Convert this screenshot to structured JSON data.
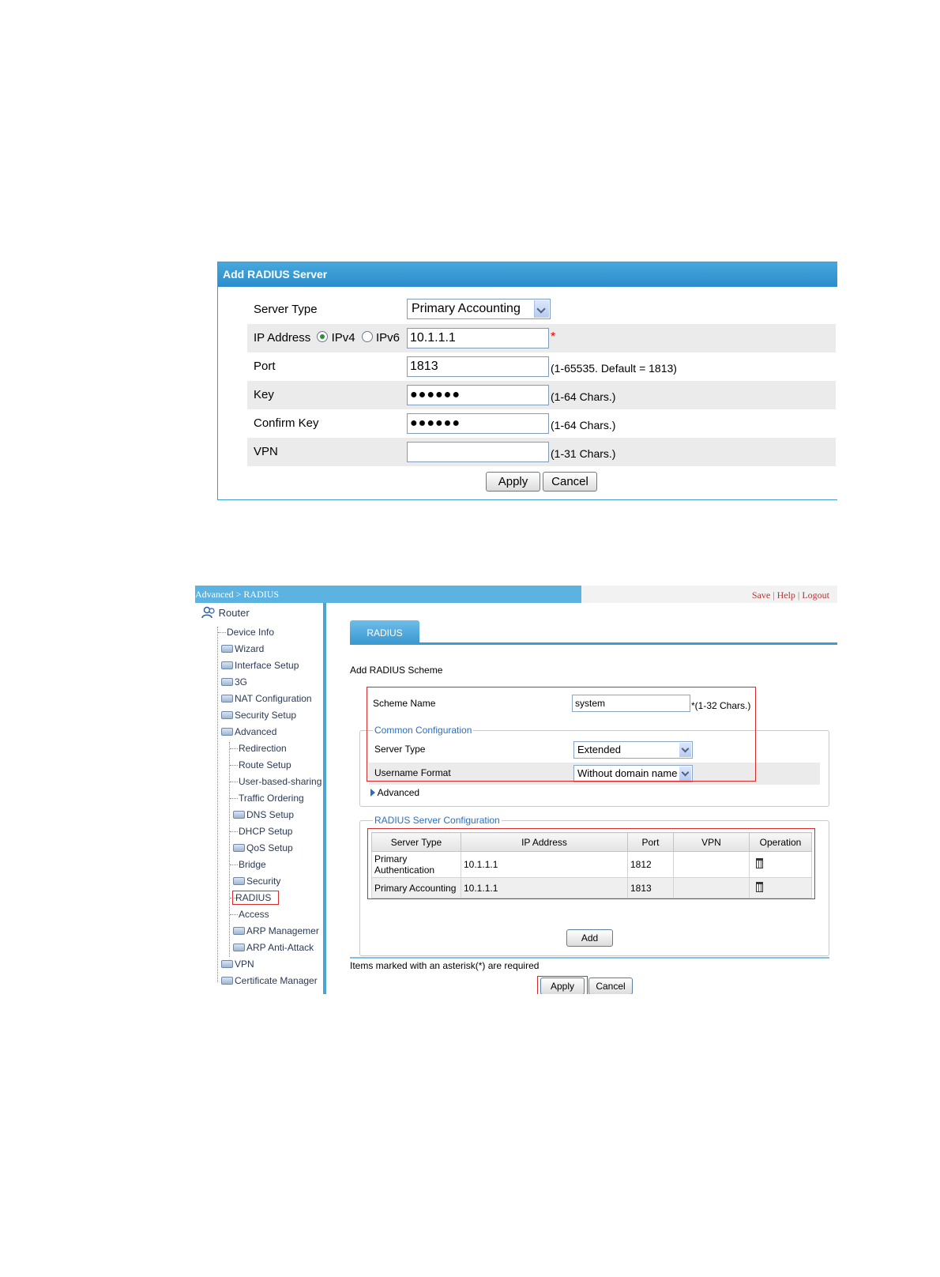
{
  "dialog1": {
    "title": "Add RADIUS Server",
    "server_type_label": "Server Type",
    "server_type_value": "Primary Accounting",
    "ip_label": "IP Address",
    "ipv4_label": "IPv4",
    "ipv6_label": "IPv6",
    "ip_value": "10.1.1.1",
    "required_mark": "*",
    "port_label": "Port",
    "port_value": "1813",
    "port_hint": "(1-65535. Default = 1813)",
    "key_label": "Key",
    "key_value": "●●●●●●",
    "key_hint": "(1-64 Chars.)",
    "confirm_label": "Confirm Key",
    "confirm_value": "●●●●●●",
    "confirm_hint": "(1-64 Chars.)",
    "vpn_label": "VPN",
    "vpn_value": "",
    "vpn_hint": "(1-31 Chars.)",
    "apply": "Apply",
    "cancel": "Cancel"
  },
  "ui": {
    "breadcrumb": "Advanced > RADIUS",
    "links": {
      "save": "Save",
      "sep": "|",
      "help": "Help",
      "logout": "Logout"
    },
    "sidebar": {
      "root": "Router",
      "items": [
        "Device Info",
        "Wizard",
        "Interface Setup",
        "3G",
        "NAT Configuration",
        "Security Setup",
        "Advanced",
        "Redirection",
        "Route Setup",
        "User-based-sharing",
        "Traffic Ordering",
        "DNS Setup",
        "DHCP Setup",
        "QoS Setup",
        "Bridge",
        "Security",
        "RADIUS",
        "Access",
        "ARP Managemer",
        "ARP Anti-Attack",
        "VPN",
        "Certificate Manager"
      ]
    },
    "tab": "RADIUS",
    "heading": "Add RADIUS Scheme",
    "scheme_name_label": "Scheme Name",
    "scheme_name_value": "system",
    "scheme_hint": "*(1-32 Chars.)",
    "common_legend": "Common Configuration",
    "server_type_label": "Server Type",
    "server_type_value": "Extended",
    "username_format_label": "Username Format",
    "username_format_value": "Without domain name",
    "advanced_label": "Advanced",
    "server_legend": "RADIUS Server Configuration",
    "table": {
      "headers": [
        "Server Type",
        "IP Address",
        "Port",
        "VPN",
        "Operation"
      ],
      "rows": [
        {
          "type": "Primary Authentication",
          "ip": "10.1.1.1",
          "port": "1812",
          "vpn": ""
        },
        {
          "type": "Primary Accounting",
          "ip": "10.1.1.1",
          "port": "1813",
          "vpn": ""
        }
      ]
    },
    "add": "Add",
    "required_note": "Items marked with an asterisk(*) are required",
    "apply": "Apply",
    "cancel": "Cancel"
  }
}
